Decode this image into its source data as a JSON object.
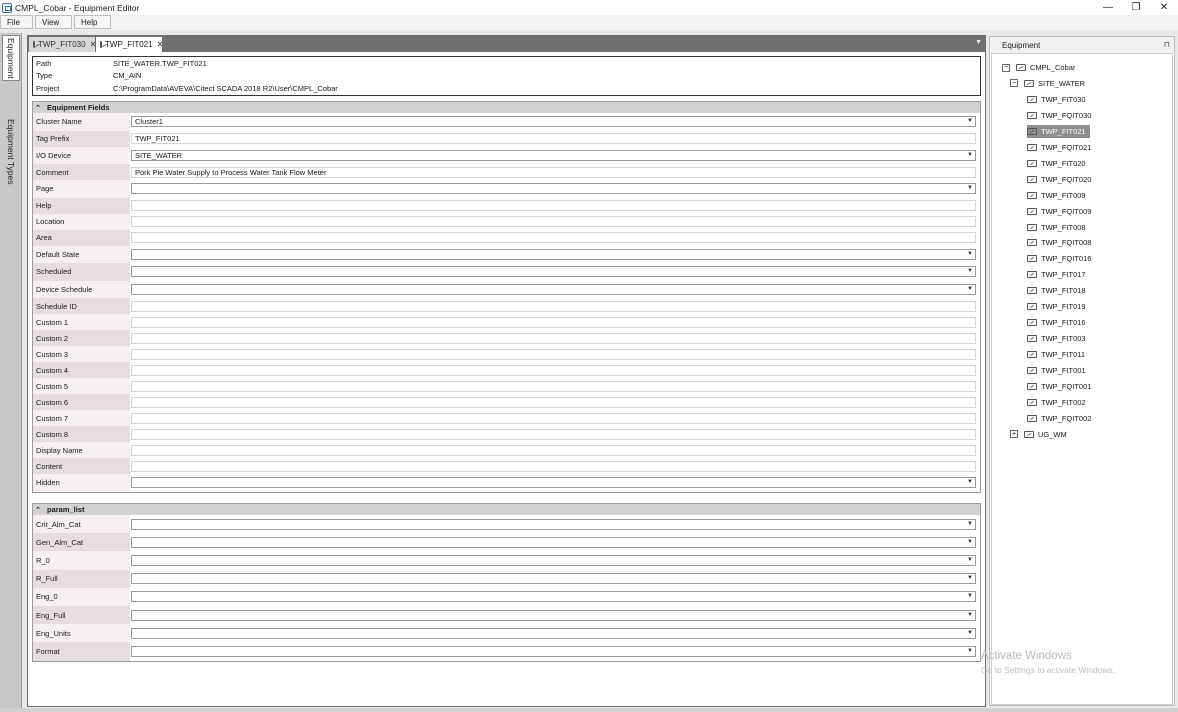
{
  "window": {
    "title": "CMPL_Cobar - Equipment Editor",
    "min": "—",
    "restore": "❐",
    "close": "✕"
  },
  "menu": {
    "file": "File",
    "view": "View",
    "help": "Help"
  },
  "side_tabs": {
    "equipment": "Equipment",
    "equipment_types": "Equipment Types"
  },
  "doc_tabs": [
    {
      "label": "TWP_FIT030",
      "active": false
    },
    {
      "label": "TWP_FIT021",
      "active": true
    }
  ],
  "info": {
    "path_label": "Path",
    "path_value": "SITE_WATER.TWP_FIT021",
    "type_label": "Type",
    "type_value": "CM_AIN",
    "project_label": "Project",
    "project_value": "C:\\ProgramData\\AVEVA\\Citect SCADA 2018 R2\\User\\CMPL_Cobar"
  },
  "equipment_fields": {
    "title": "Equipment Fields",
    "rows": [
      {
        "label": "Cluster Name",
        "value": "Cluster1",
        "combo": true
      },
      {
        "label": "Tag Prefix",
        "value": "TWP_FIT021",
        "combo": false
      },
      {
        "label": "I/O Device",
        "value": "SITE_WATER",
        "combo": true
      },
      {
        "label": "Comment",
        "value": "Pork Pie Water Supply to Process Water Tank Flow Meter",
        "combo": false
      },
      {
        "label": "Page",
        "value": "",
        "combo": true
      },
      {
        "label": "Help",
        "value": "",
        "combo": false
      },
      {
        "label": "Location",
        "value": "",
        "combo": false
      },
      {
        "label": "Area",
        "value": "",
        "combo": false
      },
      {
        "label": "Default State",
        "value": "",
        "combo": true
      },
      {
        "label": "Scheduled",
        "value": "",
        "combo": true
      },
      {
        "label": "Device Schedule",
        "value": "",
        "combo": true
      },
      {
        "label": "Schedule ID",
        "value": "",
        "combo": false
      },
      {
        "label": "Custom 1",
        "value": "",
        "combo": false
      },
      {
        "label": "Custom 2",
        "value": "",
        "combo": false
      },
      {
        "label": "Custom 3",
        "value": "",
        "combo": false
      },
      {
        "label": "Custom 4",
        "value": "",
        "combo": false
      },
      {
        "label": "Custom 5",
        "value": "",
        "combo": false
      },
      {
        "label": "Custom 6",
        "value": "",
        "combo": false
      },
      {
        "label": "Custom 7",
        "value": "",
        "combo": false
      },
      {
        "label": "Custom 8",
        "value": "",
        "combo": false
      },
      {
        "label": "Display Name",
        "value": "",
        "combo": false
      },
      {
        "label": "Content",
        "value": "",
        "combo": false
      },
      {
        "label": "Hidden",
        "value": "",
        "combo": true
      }
    ]
  },
  "param_list": {
    "title": "param_list",
    "rows": [
      {
        "label": "Crit_Alm_Cat",
        "value": "",
        "combo": true
      },
      {
        "label": "Gen_Alm_Cat",
        "value": "",
        "combo": true
      },
      {
        "label": "R_0",
        "value": "",
        "combo": true
      },
      {
        "label": "R_Full",
        "value": "",
        "combo": true
      },
      {
        "label": "Eng_0",
        "value": "",
        "combo": true
      },
      {
        "label": "Eng_Full",
        "value": "",
        "combo": true
      },
      {
        "label": "Eng_Units",
        "value": "",
        "combo": true
      },
      {
        "label": "Format",
        "value": "",
        "combo": true
      }
    ]
  },
  "equipment_panel": {
    "title": "Equipment",
    "tree": [
      {
        "label": "CMPL_Cobar",
        "level": 0,
        "toggle": "−",
        "selected": false
      },
      {
        "label": "SITE_WATER",
        "level": 1,
        "toggle": "−",
        "selected": false
      },
      {
        "label": "TWP_FIT030",
        "level": 2,
        "toggle": "",
        "selected": false
      },
      {
        "label": "TWP_FQIT030",
        "level": 2,
        "toggle": "",
        "selected": false
      },
      {
        "label": "TWP_FIT021",
        "level": 2,
        "toggle": "",
        "selected": true
      },
      {
        "label": "TWP_FQIT021",
        "level": 2,
        "toggle": "",
        "selected": false
      },
      {
        "label": "TWP_FIT020",
        "level": 2,
        "toggle": "",
        "selected": false
      },
      {
        "label": "TWP_FQIT020",
        "level": 2,
        "toggle": "",
        "selected": false
      },
      {
        "label": "TWP_FIT009",
        "level": 2,
        "toggle": "",
        "selected": false
      },
      {
        "label": "TWP_FQIT009",
        "level": 2,
        "toggle": "",
        "selected": false
      },
      {
        "label": "TWP_FIT008",
        "level": 2,
        "toggle": "",
        "selected": false
      },
      {
        "label": "TWP_FQIT008",
        "level": 2,
        "toggle": "",
        "selected": false
      },
      {
        "label": "TWP_FQIT016",
        "level": 2,
        "toggle": "",
        "selected": false
      },
      {
        "label": "TWP_FIT017",
        "level": 2,
        "toggle": "",
        "selected": false
      },
      {
        "label": "TWP_FIT018",
        "level": 2,
        "toggle": "",
        "selected": false
      },
      {
        "label": "TWP_FIT019",
        "level": 2,
        "toggle": "",
        "selected": false
      },
      {
        "label": "TWP_FIT016",
        "level": 2,
        "toggle": "",
        "selected": false
      },
      {
        "label": "TWP_FIT003",
        "level": 2,
        "toggle": "",
        "selected": false
      },
      {
        "label": "TWP_FIT011",
        "level": 2,
        "toggle": "",
        "selected": false
      },
      {
        "label": "TWP_FIT001",
        "level": 2,
        "toggle": "",
        "selected": false
      },
      {
        "label": "TWP_FQIT001",
        "level": 2,
        "toggle": "",
        "selected": false
      },
      {
        "label": "TWP_FIT002",
        "level": 2,
        "toggle": "",
        "selected": false
      },
      {
        "label": "TWP_FQIT002",
        "level": 2,
        "toggle": "",
        "selected": false
      },
      {
        "label": "UG_WM",
        "level": 1,
        "toggle": "+",
        "selected": false
      }
    ]
  },
  "watermark": {
    "line1": "Activate Windows",
    "line2": "Go to Settings to activate Windows."
  }
}
